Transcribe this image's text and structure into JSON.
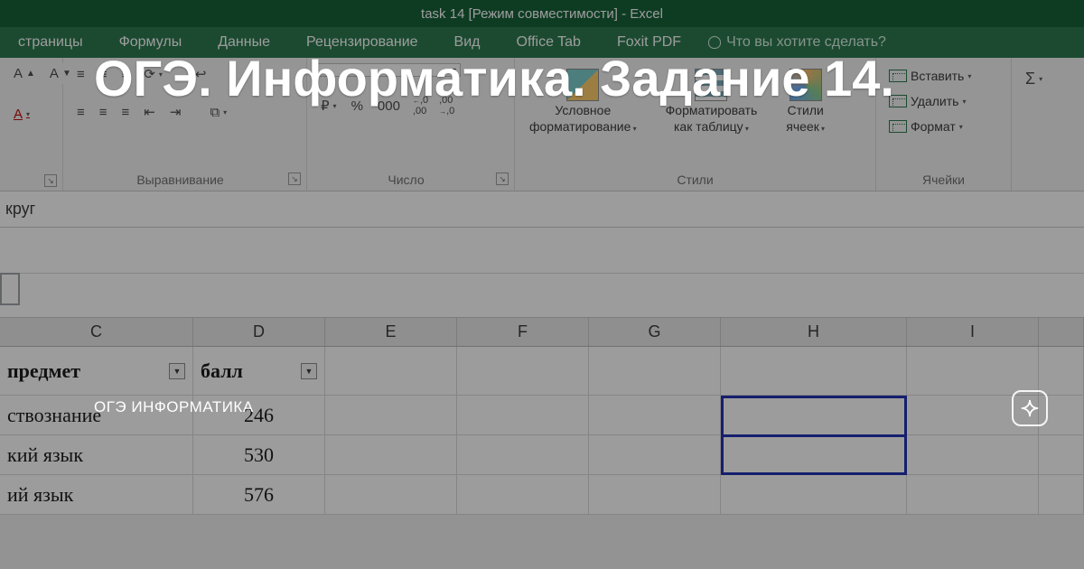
{
  "title_bar": "task 14  [Режим совместимости] - Excel",
  "tabs": [
    "страницы",
    "Формулы",
    "Данные",
    "Рецензирование",
    "Вид",
    "Office Tab",
    "Foxit PDF"
  ],
  "tell_me": "Что вы хотите сделать?",
  "alignment_group": "Выравнивание",
  "number_group": "Число",
  "styles_group": "Стили",
  "cells_group": "Ячейки",
  "currency_symbol": "₽",
  "percent_symbol": "%",
  "thousands_symbol": "000",
  "inc_dec": {
    "a": ",0",
    "b": ",00"
  },
  "styles": {
    "cond": {
      "l1": "Условное",
      "l2": "форматирование"
    },
    "table": {
      "l1": "Форматировать",
      "l2": "как таблицу"
    },
    "cell": {
      "l1": "Стили",
      "l2": "ячеек"
    }
  },
  "cells": {
    "insert": "Вставить",
    "delete": "Удалить",
    "format": "Формат"
  },
  "formula_bar_text": "круг",
  "columns": {
    "c": "C",
    "d": "D",
    "e": "E",
    "f": "F",
    "g": "G",
    "h": "H",
    "i": "I"
  },
  "headers": {
    "c": "предмет",
    "d": "балл"
  },
  "rows": [
    {
      "c": "ствознание",
      "d": "246"
    },
    {
      "c": "кий язык",
      "d": "530"
    },
    {
      "c": "ий язык",
      "d": "576"
    }
  ],
  "overlay": {
    "title": "ОГЭ. Информатика. Задание 14.",
    "subtitle": "ОГЭ ИНФОРМАТИКА"
  },
  "sigma": "Σ"
}
